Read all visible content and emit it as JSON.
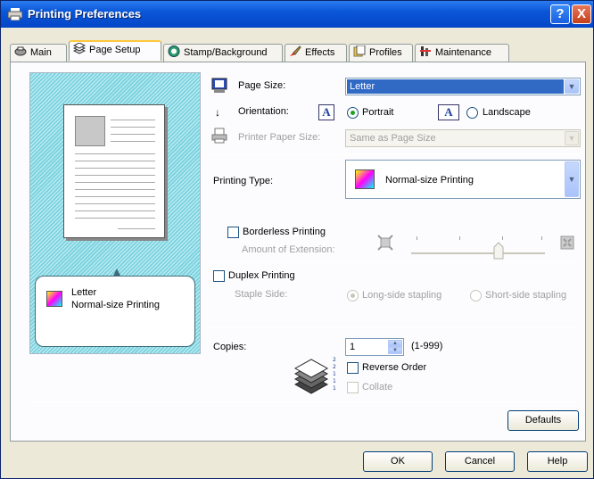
{
  "window": {
    "title": "Printing Preferences",
    "help_label": "?",
    "close_label": "X"
  },
  "tabs": [
    {
      "label": "Main",
      "icon": "printer-icon"
    },
    {
      "label": "Page Setup",
      "icon": "pages-icon",
      "active": true
    },
    {
      "label": "Stamp/Background",
      "icon": "stamp-icon"
    },
    {
      "label": "Effects",
      "icon": "brush-icon"
    },
    {
      "label": "Profiles",
      "icon": "profile-icon"
    },
    {
      "label": "Maintenance",
      "icon": "tools-icon"
    }
  ],
  "preview": {
    "line1": "Letter",
    "line2": "Normal-size Printing"
  },
  "page_size": {
    "label": "Page Size:",
    "value": "Letter"
  },
  "orientation": {
    "label": "Orientation:",
    "portrait": "Portrait",
    "landscape": "Landscape",
    "selected": "Portrait",
    "icon_glyph": "A"
  },
  "printer_paper_size": {
    "label": "Printer Paper Size:",
    "value": "Same as Page Size"
  },
  "printing_type": {
    "label": "Printing Type:",
    "value": "Normal-size Printing"
  },
  "borderless": {
    "label": "Borderless Printing",
    "extension_label": "Amount of Extension:"
  },
  "duplex": {
    "label": "Duplex Printing",
    "staple_label": "Staple Side:",
    "long_side": "Long-side stapling",
    "short_side": "Short-side stapling"
  },
  "copies": {
    "label": "Copies:",
    "value": "1",
    "range": "(1-999)",
    "reverse_order": "Reverse Order",
    "collate": "Collate"
  },
  "buttons": {
    "defaults": "Defaults",
    "ok": "OK",
    "cancel": "Cancel",
    "help": "Help"
  },
  "colors": {
    "titlebar": "#0a56d8",
    "accent": "#316ac5",
    "tab_highlight": "#ffc83c",
    "preview_bg": "#7ed3e0"
  }
}
